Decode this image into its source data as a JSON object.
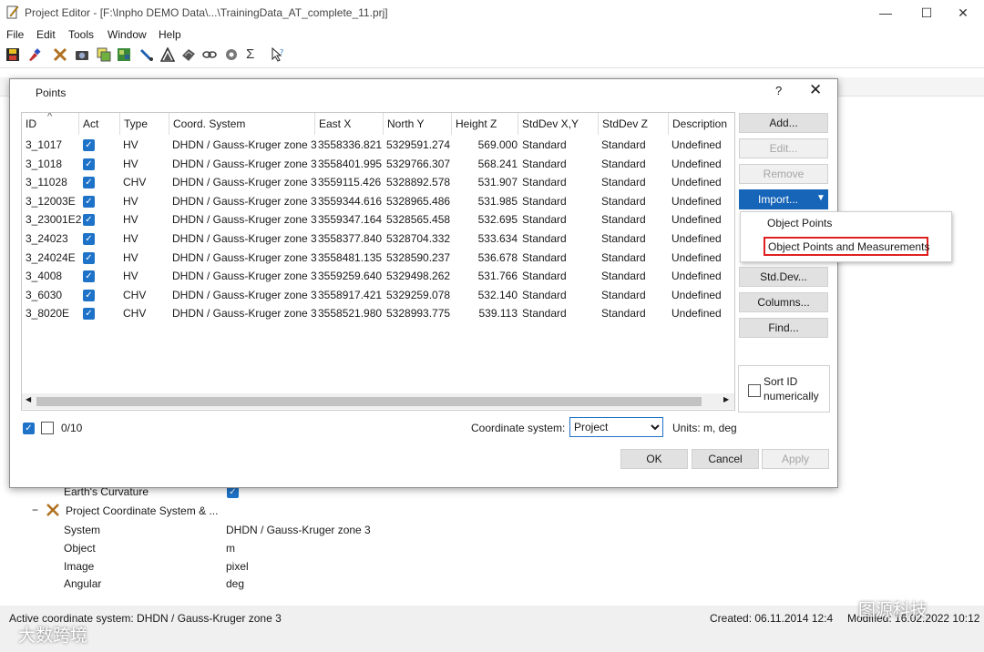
{
  "window": {
    "title": "Project Editor - [F:\\Inpho DEMO Data\\...\\TrainingData_AT_complete_11.prj]",
    "minimize_glyph": "—",
    "maximize_glyph": "☐",
    "close_glyph": "✕"
  },
  "menu": [
    "File",
    "Edit",
    "Tools",
    "Window",
    "Help"
  ],
  "toolbar_icons": [
    "save-icon",
    "brush-icon",
    "tools-icon",
    "camera-icon",
    "images-icon",
    "ortho-icon",
    "pen-icon",
    "triangle-icon",
    "surface-icon",
    "chain-icon",
    "gear-icon",
    "sigma-icon",
    "pointer-help-icon"
  ],
  "dialog": {
    "title": "Points",
    "help_glyph": "?",
    "close_glyph": "✕",
    "columns": [
      "ID",
      "Act",
      "Type",
      "Coord. System",
      "East X",
      "North Y",
      "Height Z",
      "StdDev X,Y",
      "StdDev Z",
      "Description"
    ],
    "sort_glyph": "^",
    "rows": [
      {
        "id": "3_1017",
        "type": "HV",
        "coord": "DHDN / Gauss-Kruger zone 3",
        "east": "3558336.821",
        "north": "5329591.274",
        "height": "569.000",
        "sdxy": "Standard",
        "sdz": "Standard",
        "desc": "Undefined"
      },
      {
        "id": "3_1018",
        "type": "HV",
        "coord": "DHDN / Gauss-Kruger zone 3",
        "east": "3558401.995",
        "north": "5329766.307",
        "height": "568.241",
        "sdxy": "Standard",
        "sdz": "Standard",
        "desc": "Undefined"
      },
      {
        "id": "3_11028",
        "type": "CHV",
        "coord": "DHDN / Gauss-Kruger zone 3",
        "east": "3559115.426",
        "north": "5328892.578",
        "height": "531.907",
        "sdxy": "Standard",
        "sdz": "Standard",
        "desc": "Undefined"
      },
      {
        "id": "3_12003E",
        "type": "HV",
        "coord": "DHDN / Gauss-Kruger zone 3",
        "east": "3559344.616",
        "north": "5328965.486",
        "height": "531.985",
        "sdxy": "Standard",
        "sdz": "Standard",
        "desc": "Undefined"
      },
      {
        "id": "3_23001E2",
        "type": "HV",
        "coord": "DHDN / Gauss-Kruger zone 3",
        "east": "3559347.164",
        "north": "5328565.458",
        "height": "532.695",
        "sdxy": "Standard",
        "sdz": "Standard",
        "desc": "Undefined"
      },
      {
        "id": "3_24023",
        "type": "HV",
        "coord": "DHDN / Gauss-Kruger zone 3",
        "east": "3558377.840",
        "north": "5328704.332",
        "height": "533.634",
        "sdxy": "Standard",
        "sdz": "Standard",
        "desc": "Undefined"
      },
      {
        "id": "3_24024E",
        "type": "HV",
        "coord": "DHDN / Gauss-Kruger zone 3",
        "east": "3558481.135",
        "north": "5328590.237",
        "height": "536.678",
        "sdxy": "Standard",
        "sdz": "Standard",
        "desc": "Undefined"
      },
      {
        "id": "3_4008",
        "type": "HV",
        "coord": "DHDN / Gauss-Kruger zone 3",
        "east": "3559259.640",
        "north": "5329498.262",
        "height": "531.766",
        "sdxy": "Standard",
        "sdz": "Standard",
        "desc": "Undefined"
      },
      {
        "id": "3_6030",
        "type": "CHV",
        "coord": "DHDN / Gauss-Kruger zone 3",
        "east": "3558917.421",
        "north": "5329259.078",
        "height": "532.140",
        "sdxy": "Standard",
        "sdz": "Standard",
        "desc": "Undefined"
      },
      {
        "id": "3_8020E",
        "type": "CHV",
        "coord": "DHDN / Gauss-Kruger zone 3",
        "east": "3558521.980",
        "north": "5328993.775",
        "height": "539.113",
        "sdxy": "Standard",
        "sdz": "Standard",
        "desc": "Undefined"
      }
    ],
    "buttons": {
      "add": "Add...",
      "edit": "Edit...",
      "remove": "Remove",
      "import": "Import...",
      "stddev": "Std.Dev...",
      "columns": "Columns...",
      "find": "Find...",
      "ok": "OK",
      "cancel": "Cancel",
      "apply": "Apply"
    },
    "import_menu": [
      "Object Points",
      "Object Points and Measurements"
    ],
    "sort_label_line1": "Sort ID",
    "sort_label_line2": "numerically",
    "selection_count": "0/10",
    "coord_system_label": "Coordinate system:",
    "coord_system_value": "Project",
    "units": "Units: m, deg"
  },
  "properties": {
    "earth_curvature": "Earth's Curvature",
    "group_label": "Project Coordinate System & ...",
    "collapse_glyph": "−",
    "rows": [
      {
        "label": "System",
        "value": "DHDN / Gauss-Kruger zone 3"
      },
      {
        "label": "Object",
        "value": "m"
      },
      {
        "label": "Image",
        "value": "pixel"
      },
      {
        "label": "Angular",
        "value": "deg"
      }
    ]
  },
  "status": {
    "active_cs": "Active coordinate system: DHDN / Gauss-Kruger zone 3",
    "created": "Created: 06.11.2014 12:4",
    "modified": "Modified: 16.02.2022 10:12"
  },
  "watermarks": {
    "left": "大数跨境",
    "right": "图源科技"
  },
  "colors": {
    "accent": "#1665b8",
    "checkbox": "#1e73c8",
    "highlight_border": "#e02020"
  }
}
